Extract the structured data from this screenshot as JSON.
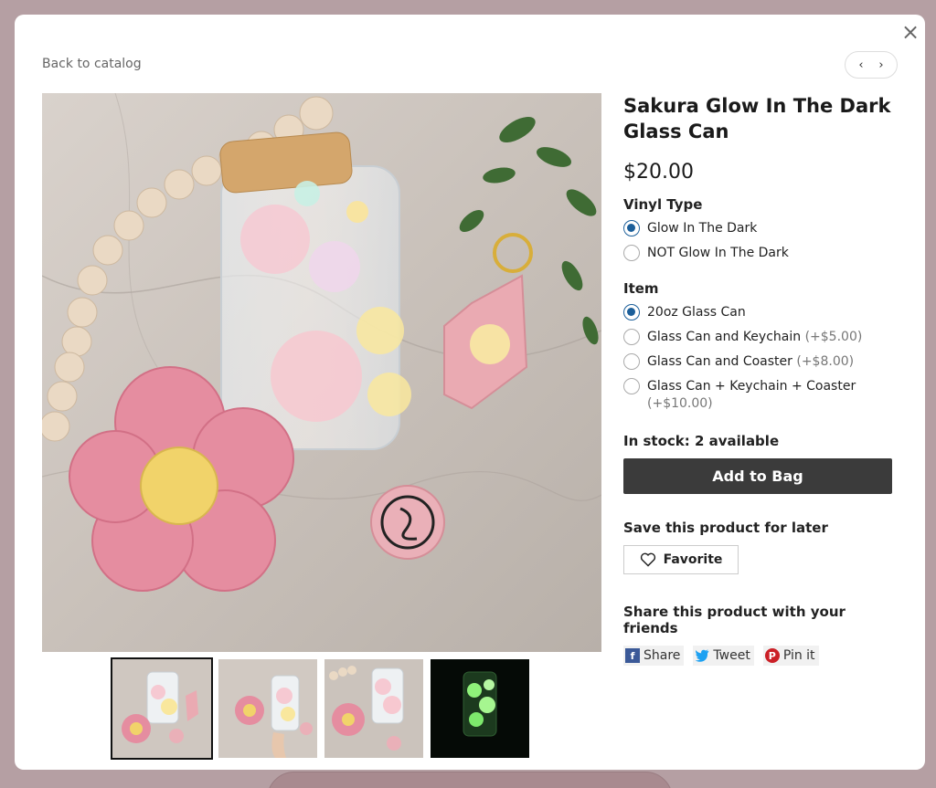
{
  "nav": {
    "back_label": "Back to catalog",
    "prev_glyph": "‹",
    "next_glyph": "›",
    "close_glyph": "×"
  },
  "product": {
    "title": "Sakura Glow In The Dark Glass Can",
    "price": "$20.00",
    "main_image_desc": "product-photo",
    "thumbnails": [
      "thumb-1",
      "thumb-2",
      "thumb-3",
      "thumb-4"
    ]
  },
  "options": {
    "vinyl": {
      "label": "Vinyl Type",
      "choices": [
        {
          "text": "Glow In The Dark",
          "extra": "",
          "selected": true
        },
        {
          "text": "NOT Glow In The Dark",
          "extra": "",
          "selected": false
        }
      ]
    },
    "item": {
      "label": "Item",
      "choices": [
        {
          "text": "20oz Glass Can",
          "extra": "",
          "selected": true
        },
        {
          "text": "Glass Can and Keychain",
          "extra": "(+$5.00)",
          "selected": false
        },
        {
          "text": "Glass Can and Coaster",
          "extra": "(+$8.00)",
          "selected": false
        },
        {
          "text": "Glass Can + Keychain + Coaster",
          "extra": "(+$10.00)",
          "selected": false
        }
      ]
    }
  },
  "stock": {
    "text": "In stock: 2 available"
  },
  "cta": {
    "add_label": "Add to Bag"
  },
  "save": {
    "title": "Save this product for later",
    "fav_label": "Favorite"
  },
  "share": {
    "title": "Share this product with your friends",
    "facebook": "Share",
    "twitter": "Tweet",
    "pinterest": "Pin it"
  },
  "colors": {
    "accent": "#1c5f9a",
    "button": "#3b3b3b",
    "backdrop": "#b59fa3"
  }
}
